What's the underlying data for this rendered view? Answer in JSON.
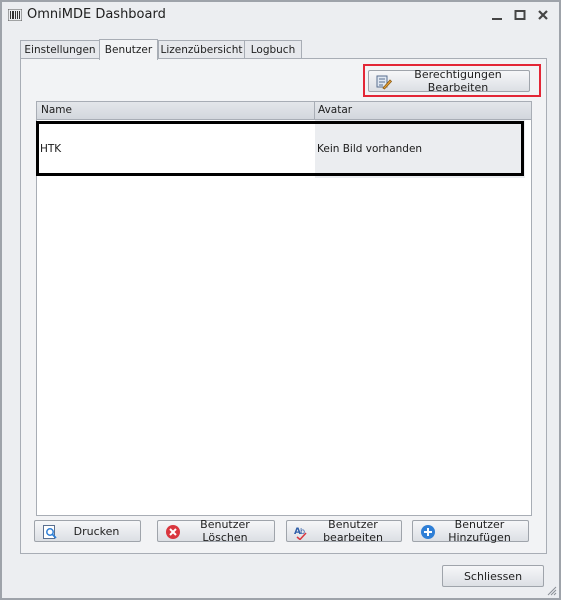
{
  "window": {
    "title": "OmniMDE Dashboard",
    "icon": "barcode-icon",
    "controls": [
      "minimize-icon",
      "maximize-icon",
      "close-icon"
    ]
  },
  "tabs": [
    {
      "label": "Einstellungen",
      "active": false
    },
    {
      "label": "Benutzer",
      "active": true
    },
    {
      "label": "Lizenzübersicht",
      "active": false
    },
    {
      "label": "Logbuch",
      "active": false
    }
  ],
  "toolbar": {
    "edit_permissions_label": "Berechtigungen Bearbeiten",
    "edit_permissions_icon": "permissions-edit-icon"
  },
  "table": {
    "columns": [
      "Name",
      "Avatar"
    ],
    "rows": [
      {
        "name": "HTK",
        "avatar": "Kein Bild vorhanden"
      }
    ]
  },
  "actions": {
    "print_label": "Drucken",
    "delete_label": "Benutzer Löschen",
    "edit_label": "Benutzer bearbeiten",
    "add_label": "Benutzer Hinzufügen"
  },
  "footer": {
    "close_label": "Schliessen"
  },
  "colors": {
    "highlight_red": "#e32636",
    "selection_outline": "#000000",
    "delete_icon_red": "#d9363e",
    "add_icon_blue": "#2f7fd6"
  }
}
